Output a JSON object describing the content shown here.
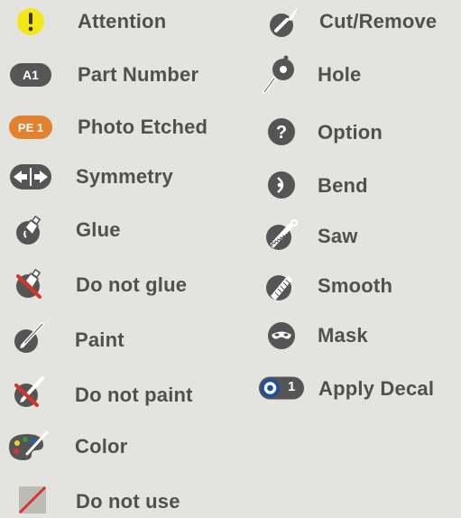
{
  "left_column": [
    {
      "label": "Attention",
      "icon": "exclamation-icon"
    },
    {
      "label": "Part Number",
      "icon": "part-number-badge",
      "badge": "A1"
    },
    {
      "label": "Photo Etched",
      "icon": "photo-etched-badge",
      "badge": "PE 1"
    },
    {
      "label": "Symmetry",
      "icon": "symmetry-arrows-icon"
    },
    {
      "label": "Glue",
      "icon": "glue-bottle-icon"
    },
    {
      "label": "Do not glue",
      "icon": "no-glue-icon"
    },
    {
      "label": "Paint",
      "icon": "paintbrush-icon"
    },
    {
      "label": "Do not paint",
      "icon": "no-paint-icon"
    },
    {
      "label": "Color",
      "icon": "palette-icon"
    },
    {
      "label": "Do not use",
      "icon": "do-not-use-icon"
    }
  ],
  "right_column": [
    {
      "label": "Cut/Remove",
      "icon": "knife-icon"
    },
    {
      "label": "Hole",
      "icon": "drill-icon"
    },
    {
      "label": "Option",
      "icon": "question-icon"
    },
    {
      "label": "Bend",
      "icon": "bend-icon"
    },
    {
      "label": "Saw",
      "icon": "saw-icon"
    },
    {
      "label": "Smooth",
      "icon": "file-icon"
    },
    {
      "label": "Mask",
      "icon": "mask-icon"
    },
    {
      "label": "Apply Decal",
      "icon": "decal-badge",
      "badge": "1"
    }
  ],
  "colors": {
    "background": "#e3e4df",
    "text": "#505050",
    "icon_dark": "#555555",
    "attention_yellow": "#f4e619",
    "photo_etched_orange": "#e3822e",
    "prohibit_red": "#d9342b",
    "decal_blue": "#1f4fa0"
  }
}
